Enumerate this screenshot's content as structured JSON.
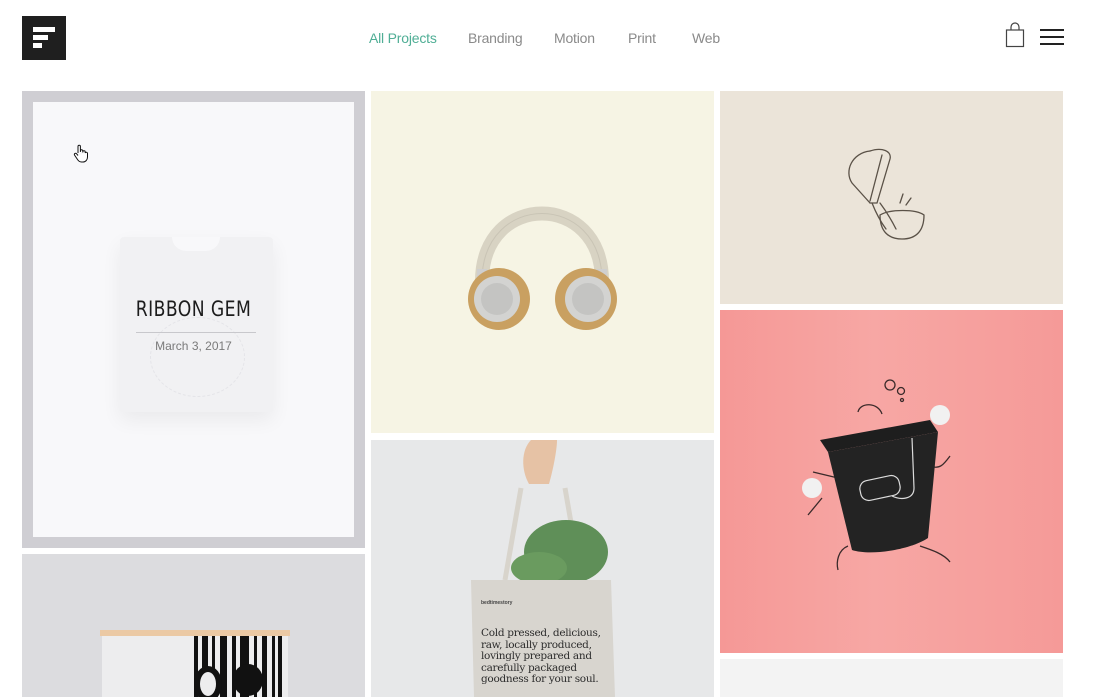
{
  "header": {
    "logo_alt": "Logo",
    "nav": [
      {
        "label": "All Projects",
        "active": true
      },
      {
        "label": "Branding",
        "active": false
      },
      {
        "label": "Motion",
        "active": false
      },
      {
        "label": "Print",
        "active": false
      },
      {
        "label": "Web",
        "active": false
      }
    ],
    "cart_icon": "shopping-bag-icon",
    "menu_icon": "hamburger-menu-icon"
  },
  "colors": {
    "accent": "#4fae95",
    "nav_text": "#8a8a8a",
    "logo_bg": "#1f1f1f"
  },
  "portfolio": {
    "items": [
      {
        "id": "ribbon-gem",
        "title": "RIBBON GEM",
        "date": "March 3, 2017",
        "image": "folded white t-shirt",
        "hovered": true
      },
      {
        "id": "headphones",
        "image": "tan headphones on cream background"
      },
      {
        "id": "pour-sketch",
        "image": "line drawing of cup pouring into bowl"
      },
      {
        "id": "trash-can",
        "image": "black trash can with drawn limbs on pink background"
      },
      {
        "id": "tote-bag",
        "image": "canvas tote bag with greens",
        "bag_brand": "bedtimestory",
        "bag_text": "Cold pressed, delicious, raw, locally produced, lovingly prepared and carefully packaged goodness for your soul."
      },
      {
        "id": "poster",
        "image": "hanging poster with black-and-white artwork"
      },
      {
        "id": "light-tile",
        "image": "light grey image"
      }
    ]
  }
}
